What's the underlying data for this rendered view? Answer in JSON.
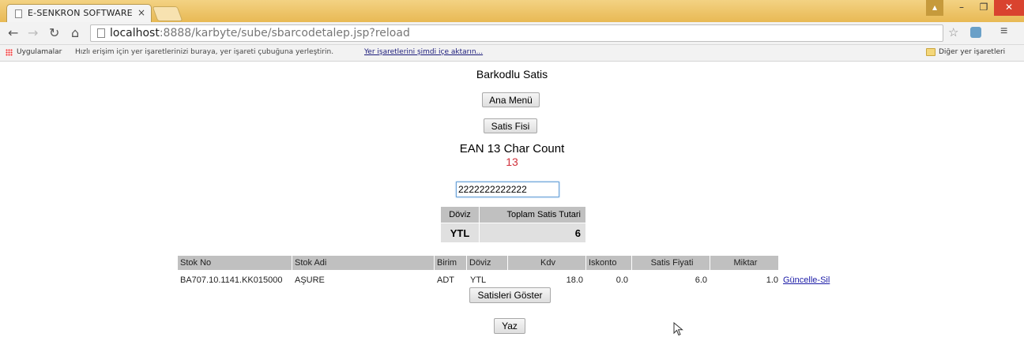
{
  "browser": {
    "tab_title": "E-SENKRON SOFTWARE",
    "tab_close": "×",
    "url_host": "localhost",
    "url_rest": ":8888/karbyte/sube/sbarcodetalep.jsp?reload",
    "bookmarks": {
      "apps": "Uygulamalar",
      "hint": "Hızlı erişim için yer işaretlerinizi buraya, yer işareti çubuğuna yerleştirin.",
      "import_link": "Yer işaretlerini şimdi içe aktarın...",
      "other": "Diğer yer işaretleri"
    }
  },
  "page": {
    "title": "Barkodlu Satis",
    "main_menu_button": "Ana Menü",
    "receipt_button": "Satis Fisi",
    "ean_label": "EAN 13 Char Count",
    "ean_count": "13",
    "barcode_value": "2222222222222",
    "summary": {
      "headers": [
        "Döviz",
        "Toplam Satis Tutari"
      ],
      "currency": "YTL",
      "total": "6"
    },
    "list": {
      "headers": [
        "Stok No",
        "Stok Adi",
        "Birim",
        "Döviz",
        "Kdv",
        "Iskonto",
        "Satis Fiyati",
        "Miktar"
      ],
      "row": {
        "stok_no": "BA707.10.1141.KK015000",
        "stok_adi": "AŞURE",
        "birim": "ADT",
        "doviz": "YTL",
        "kdv": "18.0",
        "iskonto": "0.0",
        "satis_fiyati": "6.0",
        "miktar": "1.0",
        "action": "Güncelle-Sil"
      }
    },
    "show_sales_button": "Satisleri Göster",
    "write_button": "Yaz"
  },
  "colors": {
    "titlebar": "#e8b954",
    "count": "#d0303a",
    "header_bg": "#c0c0c0",
    "link": "#1a1aa6"
  }
}
